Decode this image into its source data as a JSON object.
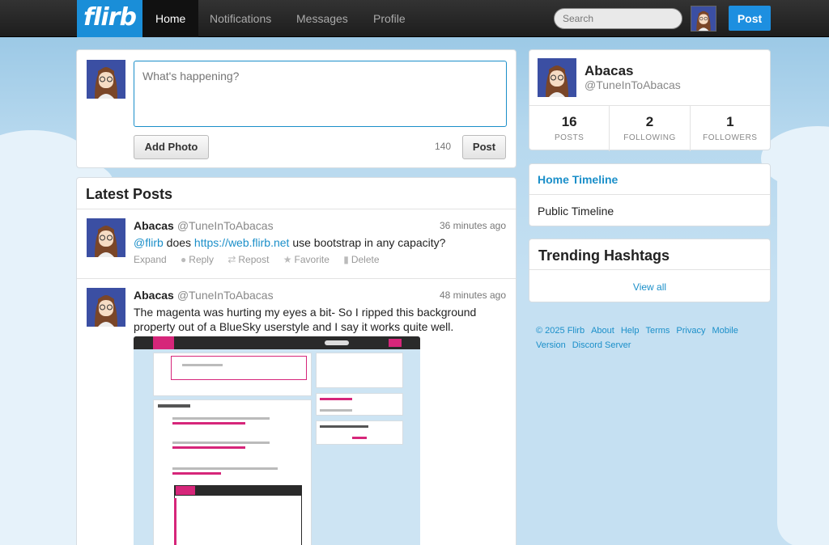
{
  "nav": {
    "logo": "flirb",
    "links": [
      "Home",
      "Notifications",
      "Messages",
      "Profile"
    ],
    "search_placeholder": "Search",
    "post_label": "Post"
  },
  "compose": {
    "placeholder": "What's happening?",
    "add_photo": "Add Photo",
    "counter": "140",
    "post": "Post"
  },
  "feed": {
    "title": "Latest Posts",
    "posts": [
      {
        "name": "Abacas",
        "handle": "@TuneInToAbacas",
        "time": "36 minutes ago",
        "mention": "@flirb",
        "text_mid": " does ",
        "url": "https://web.flirb.net",
        "text_end": " use bootstrap in any capacity?",
        "actions": [
          "Expand",
          "Reply",
          "Repost",
          "Favorite",
          "Delete"
        ]
      },
      {
        "name": "Abacas",
        "handle": "@TuneInToAbacas",
        "time": "48 minutes ago",
        "text": "The magenta was hurting my eyes a bit- So I ripped this background property out of a BlueSky userstyle and I say it works quite well."
      }
    ]
  },
  "profile": {
    "name": "Abacas",
    "handle": "@TuneInToAbacas",
    "stats": [
      {
        "value": "16",
        "label": "POSTS"
      },
      {
        "value": "2",
        "label": "FOLLOWING"
      },
      {
        "value": "1",
        "label": "FOLLOWERS"
      }
    ]
  },
  "timelines": [
    "Home Timeline",
    "Public Timeline"
  ],
  "trending": {
    "title": "Trending Hashtags",
    "view_all": "View all"
  },
  "footer": [
    "© 2025 Flirb",
    "About",
    "Help",
    "Terms",
    "Privacy",
    "Mobile",
    "Version",
    "Discord Server"
  ],
  "colors": {
    "accent": "#1b8fc9",
    "logo_bg": "#1a8ed8",
    "post_button": "#1d8fe0",
    "embedded_accent": "#d6267a"
  }
}
